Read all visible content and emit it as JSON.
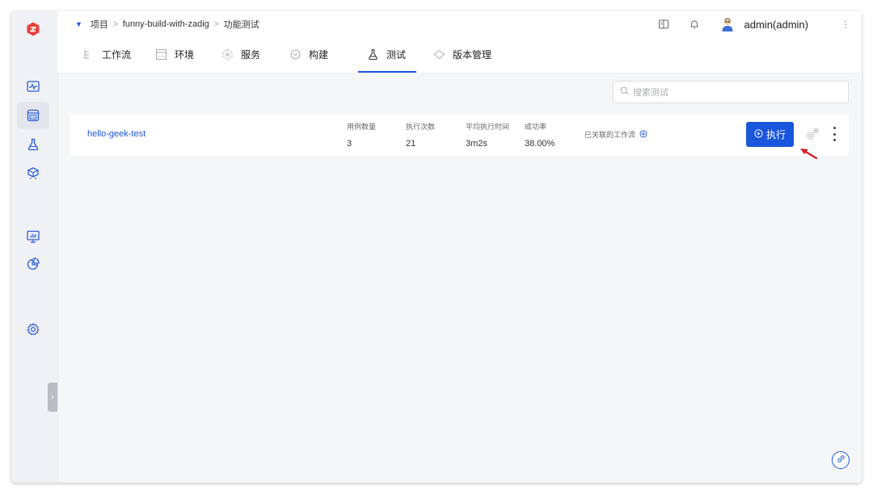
{
  "breadcrumb": {
    "root": "项目",
    "project": "funny-build-with-zadig",
    "page": "功能测试",
    "separator": ">"
  },
  "user": {
    "name": "admin(admin)"
  },
  "tabs": [
    {
      "label": "工作流",
      "icon": "workflow-icon"
    },
    {
      "label": "环境",
      "icon": "environment-icon"
    },
    {
      "label": "服务",
      "icon": "service-icon"
    },
    {
      "label": "构建",
      "icon": "build-icon"
    },
    {
      "label": "测试",
      "icon": "test-flask-icon",
      "active": true
    },
    {
      "label": "版本管理",
      "icon": "version-icon"
    }
  ],
  "search": {
    "placeholder": "搜索测试"
  },
  "test_row": {
    "name": "hello-geek-test",
    "stats": [
      {
        "label": "用例数量",
        "value": "3"
      },
      {
        "label": "执行次数",
        "value": "21"
      },
      {
        "label": "平均执行时间",
        "value": "3m2s"
      },
      {
        "label": "成功率",
        "value": "38.00%"
      }
    ],
    "linked_workflow_label": "已关联的工作流",
    "run_label": "执行"
  },
  "colors": {
    "accent": "#1a56db",
    "logo": "#e8413c",
    "annotation_arrow": "#d0202a"
  },
  "sidebar_icons": [
    "logo-icon",
    "monitor-wave-icon",
    "project-pm-icon",
    "test-flask-icon",
    "plugin-icon",
    "dashboard-chart-icon",
    "pie-chart-icon",
    "settings-gear-icon"
  ]
}
